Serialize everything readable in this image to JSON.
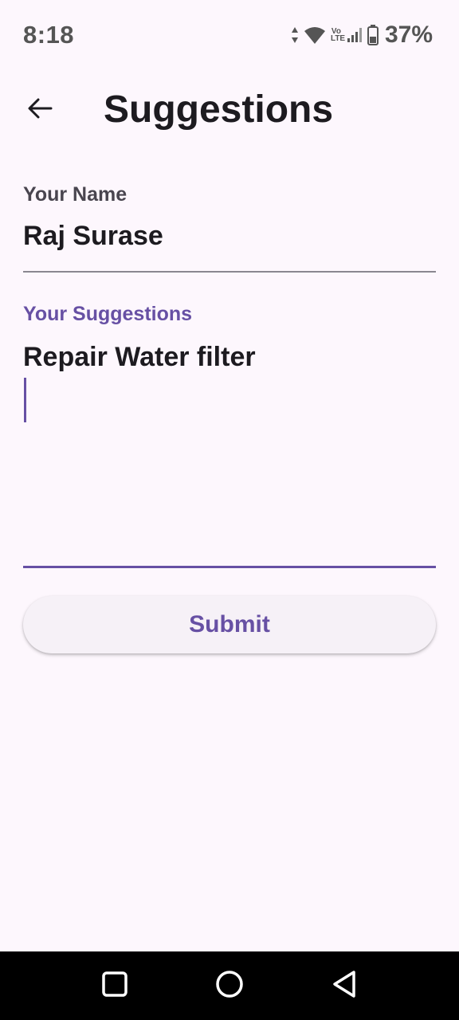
{
  "status_bar": {
    "time": "8:18",
    "battery_percent": "37%",
    "network_label_top": "Vo",
    "network_label_bottom": "LTE",
    "icons": [
      "data-arrows-icon",
      "wifi-icon",
      "volte-icon",
      "signal-icon",
      "battery-icon"
    ]
  },
  "app_bar": {
    "back_icon": "arrow-left-icon",
    "title": "Suggestions"
  },
  "form": {
    "name": {
      "label": "Your Name",
      "value": "Raj Surase"
    },
    "suggestions": {
      "label": "Your Suggestions",
      "value": "Repair Water filter"
    },
    "submit_label": "Submit"
  },
  "nav_bar": {
    "icons": [
      "recents-square-icon",
      "home-circle-icon",
      "back-triangle-icon"
    ]
  },
  "colors": {
    "background": "#FDF7FD",
    "accent": "#6750A4",
    "text": "#1D1B20",
    "label": "#49454F"
  }
}
